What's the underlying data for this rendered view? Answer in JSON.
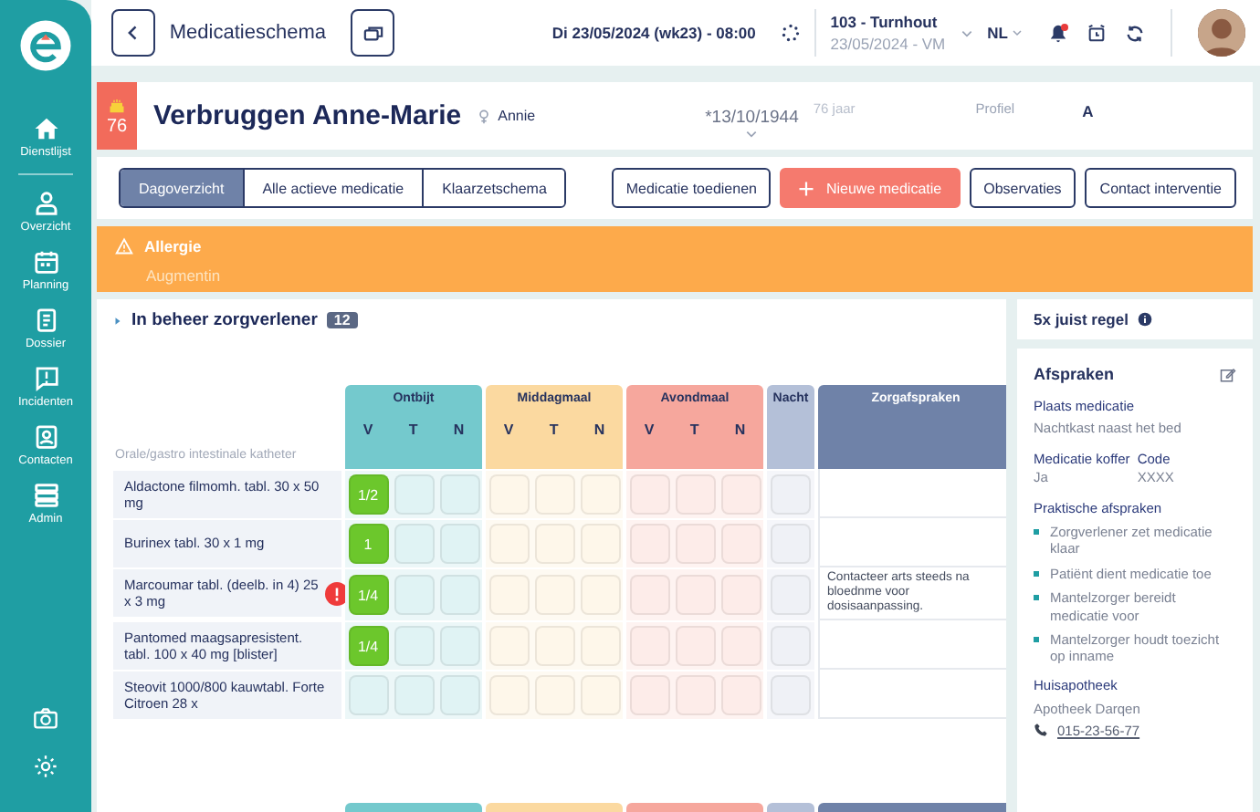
{
  "sidebar": {
    "items": [
      {
        "label": "Dienstlijst"
      },
      {
        "label": "Overzicht"
      },
      {
        "label": "Planning"
      },
      {
        "label": "Dossier"
      },
      {
        "label": "Incidenten"
      },
      {
        "label": "Contacten"
      },
      {
        "label": "Admin"
      }
    ]
  },
  "header": {
    "title": "Medicatieschema",
    "datetime": "Di 23/05/2024 (wk23) - 08:00",
    "location": "103 - Turnhout",
    "location_date": "23/05/2024 - VM",
    "language": "NL",
    "notification": true
  },
  "patient": {
    "age": "76",
    "name": "Verbruggen Anne-Marie",
    "nickname": "Annie",
    "birthdate": "*13/10/1944",
    "age_text": "76 jaar",
    "profile_label": "Profiel",
    "profile": "A"
  },
  "view_tabs": [
    {
      "label": "Dagoverzicht",
      "selected": true
    },
    {
      "label": "Alle actieve medicatie",
      "selected": false
    },
    {
      "label": "Klaarzetschema",
      "selected": false
    }
  ],
  "actions": [
    {
      "label": "Medicatie toedienen",
      "kind": "outline"
    },
    {
      "label": "Nieuwe medicatie",
      "kind": "primary"
    },
    {
      "label": "Observaties",
      "kind": "outline"
    },
    {
      "label": "Contact interventie",
      "kind": "outline"
    }
  ],
  "allergy": {
    "title": "Allergie",
    "text": "Augmentin"
  },
  "section": {
    "title": "In beheer zorgverlener",
    "count": "12"
  },
  "table": {
    "route": "Orale/gastro intestinale katheter",
    "notes_heading": "Zorgafspraken",
    "meals": [
      {
        "name": "Ontbijt",
        "color": "#74c9cd",
        "parts": [
          "V",
          "T",
          "N"
        ]
      },
      {
        "name": "Middagmaal",
        "color": "#fbd9a0",
        "parts": [
          "V",
          "T",
          "N"
        ]
      },
      {
        "name": "Avondmaal",
        "color": "#f6a79d",
        "parts": [
          "V",
          "T",
          "N"
        ]
      },
      {
        "name": "Nacht",
        "color": "#b4c0d8"
      }
    ],
    "rows": [
      {
        "name": "Aldactone filmomh. tabl. 30 x 50 mg",
        "warning": false,
        "cells": [
          {
            "filled": true,
            "dose": "1/2"
          },
          {
            "filled": false
          },
          {
            "filled": false
          },
          {
            "filled": false
          },
          {
            "filled": false
          },
          {
            "filled": false
          },
          {
            "filled": false
          },
          {
            "filled": false
          },
          {
            "filled": false
          },
          {
            "filled": false
          }
        ]
      },
      {
        "name": "Burinex tabl. 30 x 1 mg",
        "warning": false,
        "cells": [
          {
            "filled": true,
            "dose": "1"
          },
          {
            "filled": false
          },
          {
            "filled": false
          },
          {
            "filled": false
          },
          {
            "filled": false
          },
          {
            "filled": false
          },
          {
            "filled": false
          },
          {
            "filled": false
          },
          {
            "filled": false
          },
          {
            "filled": false
          }
        ]
      },
      {
        "name": "Marcoumar tabl. (deelb. in 4) 25 x 3 mg",
        "warning": true,
        "note": "Contacteer arts steeds na bloednme voor dosisaanpassing.",
        "cells": [
          {
            "filled": true,
            "dose": "1/4"
          },
          {
            "filled": false
          },
          {
            "filled": false
          },
          {
            "filled": false
          },
          {
            "filled": false
          },
          {
            "filled": false
          },
          {
            "filled": false
          },
          {
            "filled": false
          },
          {
            "filled": false
          },
          {
            "filled": false
          }
        ]
      },
      {
        "name": "Pantomed maagsapresistent. tabl. 100 x 40 mg [blister]",
        "warning": false,
        "cells": [
          {
            "filled": true,
            "dose": "1/4"
          },
          {
            "filled": false
          },
          {
            "filled": false
          },
          {
            "filled": false
          },
          {
            "filled": false
          },
          {
            "filled": false
          },
          {
            "filled": false
          },
          {
            "filled": false
          },
          {
            "filled": false
          },
          {
            "filled": false
          }
        ]
      },
      {
        "name": "Steovit 1000/800 kauwtabl. Forte Citroen 28 x",
        "warning": false,
        "cells": [
          {
            "filled": false
          },
          {
            "filled": false
          },
          {
            "filled": false
          },
          {
            "filled": false
          },
          {
            "filled": false
          },
          {
            "filled": false
          },
          {
            "filled": false
          },
          {
            "filled": false
          },
          {
            "filled": false
          },
          {
            "filled": false
          }
        ]
      }
    ]
  },
  "rule": {
    "title": "5x juist regel"
  },
  "agreements": {
    "title": "Afspraken",
    "place_label": "Plaats medicatie",
    "place": "Nachtkast naast het bed",
    "case_label": "Medicatie koffer",
    "case": "Ja",
    "code_label": "Code",
    "code": "XXXX",
    "practical_label": "Praktische afspraken",
    "practical": [
      "Zorgverlener zet medicatie klaar",
      "Patiënt dient medicatie toe",
      "Mantelzorger bereidt medicatie voor",
      "Mantelzorger houdt toezicht op inname"
    ],
    "pharmacy_label": "Huisapotheek",
    "pharmacy": "Apotheek Darqen",
    "phone": "015-23-56-77"
  }
}
